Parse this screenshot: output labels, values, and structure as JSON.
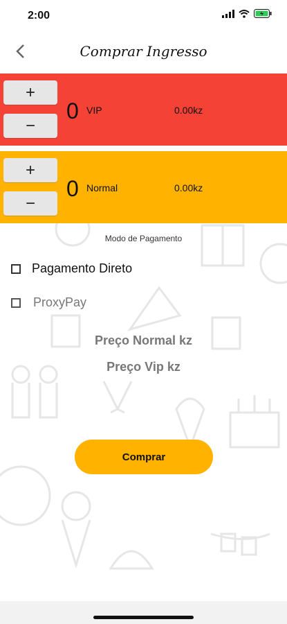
{
  "status": {
    "time": "2:00",
    "icons": [
      "signal-icon",
      "wifi-icon",
      "battery-charging-icon"
    ]
  },
  "header": {
    "title": "Comprar Ingresso",
    "back_icon": "chevron-left-icon"
  },
  "tickets": [
    {
      "qty": "0",
      "label": "VIP",
      "price": "0.00kz",
      "plus": "+",
      "minus": "−",
      "color": "#f44336"
    },
    {
      "qty": "0",
      "label": "Normal",
      "price": "0.00kz",
      "plus": "+",
      "minus": "−",
      "color": "#ffb300"
    }
  ],
  "payment": {
    "title": "Modo de Pagamento",
    "options": [
      {
        "label": "Pagamento Direto"
      },
      {
        "label": "ProxyPay"
      }
    ]
  },
  "summary": {
    "normal": "Preço Normal kz",
    "vip": "Preço Vip kz"
  },
  "buy_button": "Comprar"
}
